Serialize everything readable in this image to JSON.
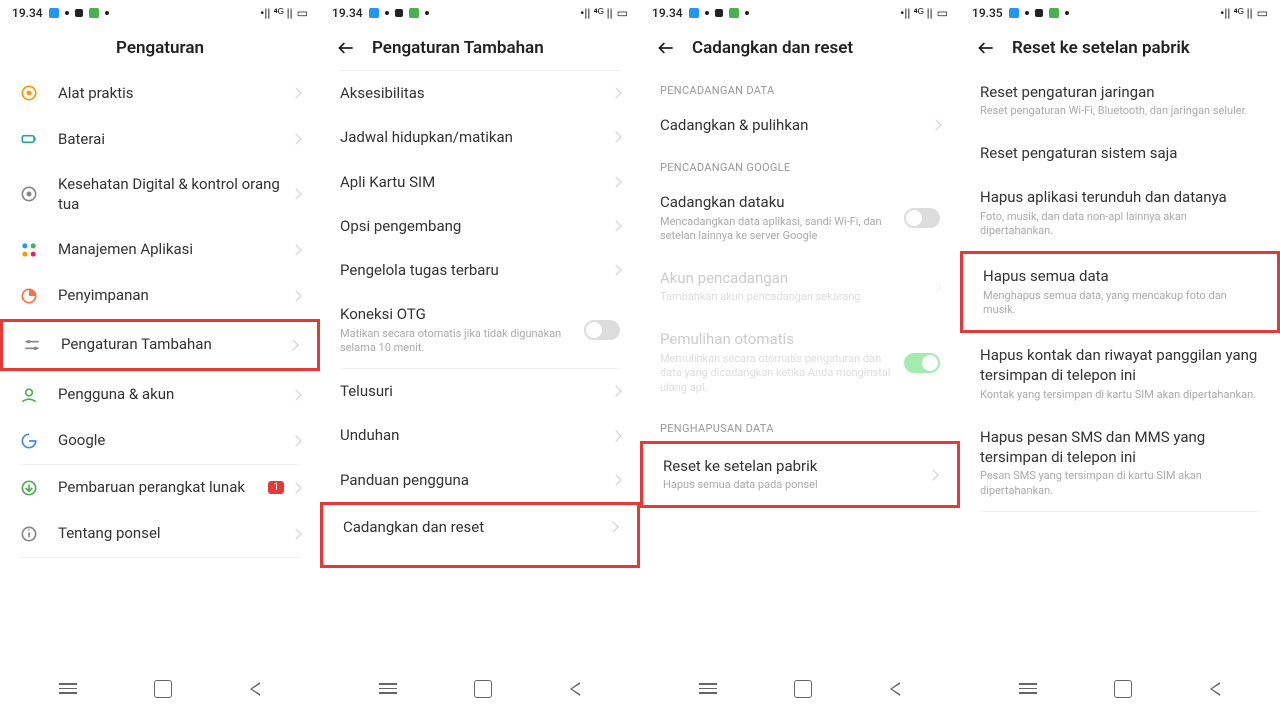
{
  "status": {
    "time1": "19.34",
    "time4": "19.35"
  },
  "s1": {
    "title": "Pengaturan",
    "rows": [
      {
        "label": "Alat praktis"
      },
      {
        "label": "Baterai"
      },
      {
        "label": "Kesehatan Digital & kontrol orang tua"
      },
      {
        "label": "Manajemen Aplikasi"
      },
      {
        "label": "Penyimpanan"
      },
      {
        "label": "Pengaturan Tambahan"
      },
      {
        "label": "Pengguna & akun"
      },
      {
        "label": "Google"
      },
      {
        "label": "Pembaruan perangkat lunak",
        "badge": "1"
      },
      {
        "label": "Tentang ponsel"
      }
    ]
  },
  "s2": {
    "title": "Pengaturan Tambahan",
    "rows": [
      {
        "label": "Aksesibilitas"
      },
      {
        "label": "Jadwal hidupkan/matikan"
      },
      {
        "label": "Apli Kartu SIM"
      },
      {
        "label": "Opsi pengembang"
      },
      {
        "label": "Pengelola tugas terbaru"
      },
      {
        "label": "Koneksi OTG",
        "sub": "Matikan secara otomatis jika tidak digunakan selama 10 menit."
      },
      {
        "label": "Telusuri"
      },
      {
        "label": "Unduhan"
      },
      {
        "label": "Panduan pengguna"
      },
      {
        "label": "Cadangkan dan reset"
      }
    ]
  },
  "s3": {
    "title": "Cadangkan dan reset",
    "sec1": "PENCADANGAN DATA",
    "sec2": "PENCADANGAN GOOGLE",
    "sec3": "PENGHAPUSAN DATA",
    "r1": {
      "label": "Cadangkan & pulihkan"
    },
    "r2": {
      "label": "Cadangkan dataku",
      "sub": "Mencadangkan data aplikasi, sandi Wi-Fi, dan setelan lainnya ke server Google"
    },
    "r3": {
      "label": "Akun pencadangan",
      "sub": "Tambahkan akun pencadangan sekarang"
    },
    "r4": {
      "label": "Pemulihan otomatis",
      "sub": "Memulihkan secara otomatis pengaturan dan data yang dicadangkan ketika Anda menginstal ulang apl."
    },
    "r5": {
      "label": "Reset ke setelan pabrik",
      "sub": "Hapus semua data pada ponsel"
    }
  },
  "s4": {
    "title": "Reset ke setelan pabrik",
    "r1": {
      "label": "Reset pengaturan jaringan",
      "sub": "Reset pengaturan Wi-Fi, Bluetooth, dan jaringan seluler."
    },
    "r2": {
      "label": "Reset pengaturan sistem saja"
    },
    "r3": {
      "label": "Hapus aplikasi terunduh dan datanya",
      "sub": "Foto, musik, dan data non-apl lainnya akan dipertahankan."
    },
    "r4": {
      "label": "Hapus semua data",
      "sub": "Menghapus semua data, yang mencakup foto dan musik."
    },
    "r5": {
      "label": "Hapus kontak dan riwayat panggilan yang tersimpan di telepon ini",
      "sub": "Kontak yang tersimpan di kartu SIM akan dipertahankan."
    },
    "r6": {
      "label": "Hapus pesan SMS dan MMS yang tersimpan di telepon ini",
      "sub": "Pesan SMS yang tersimpan di kartu SIM akan dipertahankan."
    }
  }
}
